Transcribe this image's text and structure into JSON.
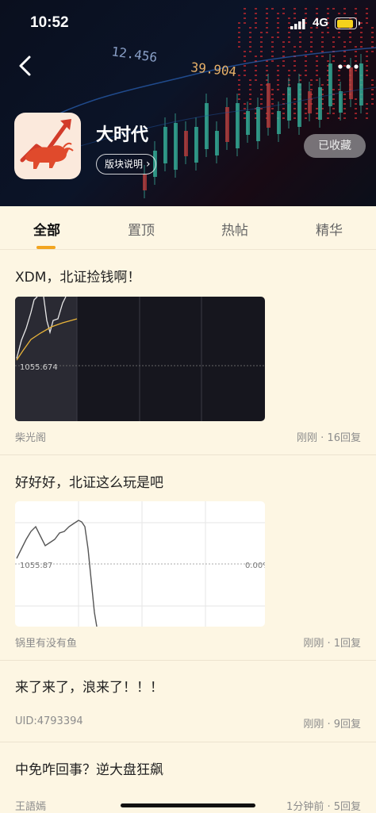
{
  "status_bar": {
    "time": "10:52",
    "network": "4G"
  },
  "header": {
    "ticker_1": "12.456",
    "ticker_2": "39.904",
    "title": "大时代",
    "info_button": "版块说明",
    "info_chevron": "›",
    "favorite_button": "已收藏"
  },
  "tabs": [
    {
      "label": "全部"
    },
    {
      "label": "置顶"
    },
    {
      "label": "热帖"
    },
    {
      "label": "精华"
    }
  ],
  "active_tab": "全部",
  "posts": [
    {
      "title": "XDM，北证捡钱啊！",
      "author": "柴光阁",
      "meta": "刚刚 · 16回复",
      "chart_label": "1055.674"
    },
    {
      "title": "好好好，北证这么玩是吧",
      "author": "锅里有没有鱼",
      "meta": "刚刚 · 1回复",
      "chart_label": "1055.87",
      "chart_label_right": "0.00%"
    },
    {
      "title": "来了来了，浪来了！！！",
      "author": "UID:4793394",
      "meta": "刚刚 · 9回复"
    },
    {
      "title": "中免咋回事？逆大盘狂飙",
      "author": "王語嫣",
      "meta": "1分钟前 · 5回复"
    }
  ],
  "colors": {
    "accent": "#f2a520",
    "background": "#fdf6e3",
    "dark_chart": "#16161e",
    "chart_line_yellow": "#e9b43a"
  },
  "icons": [
    "back-arrow-icon",
    "more-dots-icon",
    "signal-icon",
    "battery-icon",
    "bull-logo-icon",
    "chevron-right-icon"
  ]
}
